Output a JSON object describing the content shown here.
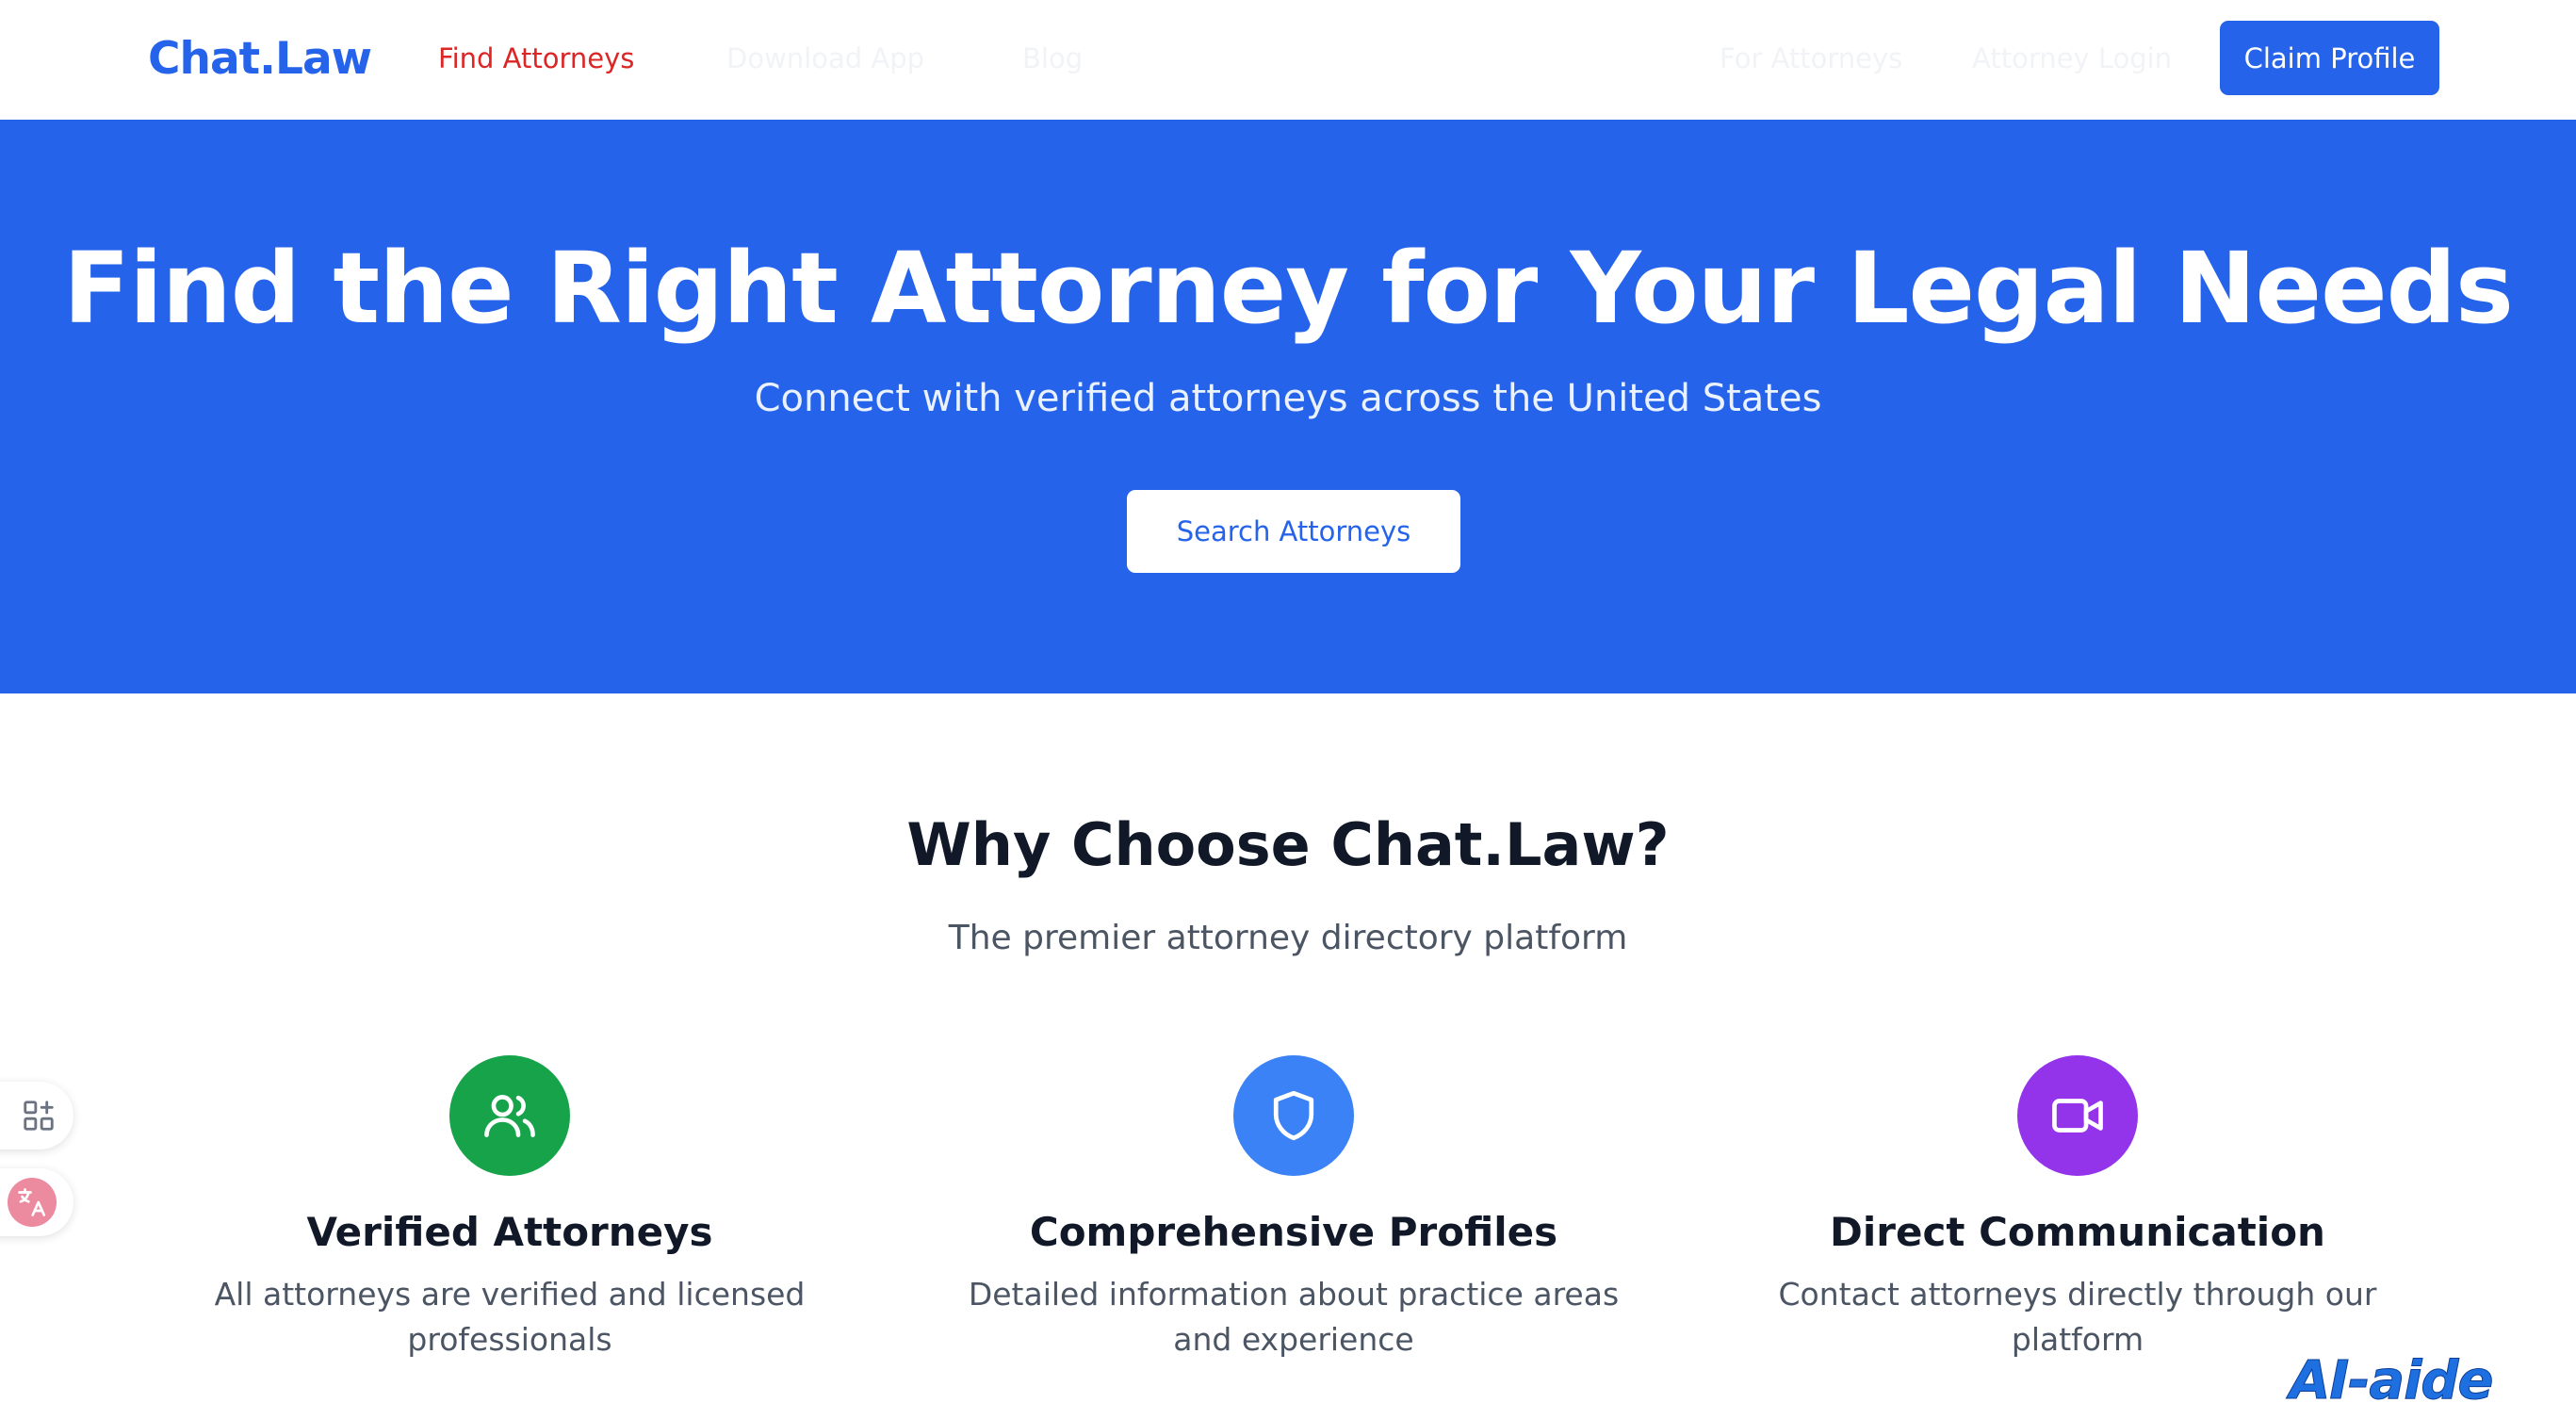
{
  "navbar": {
    "logo": "Chat.Law",
    "links": [
      {
        "label": "Find Attorneys",
        "state": "active"
      },
      {
        "label": "Download App",
        "state": "faded"
      },
      {
        "label": "Blog",
        "state": "faded"
      },
      {
        "label": "For Attorneys",
        "state": "faded"
      },
      {
        "label": "Attorney Login",
        "state": "faded"
      }
    ],
    "cta_label": "Claim Profile"
  },
  "hero": {
    "title": "Find the Right Attorney for Your Legal Needs",
    "subtitle": "Connect with verified attorneys across the United States",
    "button_label": "Search Attorneys"
  },
  "why": {
    "title": "Why Choose Chat.Law?",
    "subtitle": "The premier attorney directory platform",
    "features": [
      {
        "icon": "users-icon",
        "color": "#16a34a",
        "title": "Verified Attorneys",
        "description": "All attorneys are verified and licensed professionals"
      },
      {
        "icon": "shield-icon",
        "color": "#3b82f6",
        "title": "Comprehensive Profiles",
        "description": "Detailed information about practice areas and experience"
      },
      {
        "icon": "video-icon",
        "color": "#9333ea",
        "title": "Direct Communication",
        "description": "Contact attorneys directly through our platform"
      }
    ]
  },
  "side_widgets": [
    {
      "icon": "apps-add-icon"
    },
    {
      "icon": "translate-icon"
    }
  ],
  "watermark": "AI-aide",
  "colors": {
    "brand": "#2563eb",
    "active_nav": "#dc2626"
  }
}
